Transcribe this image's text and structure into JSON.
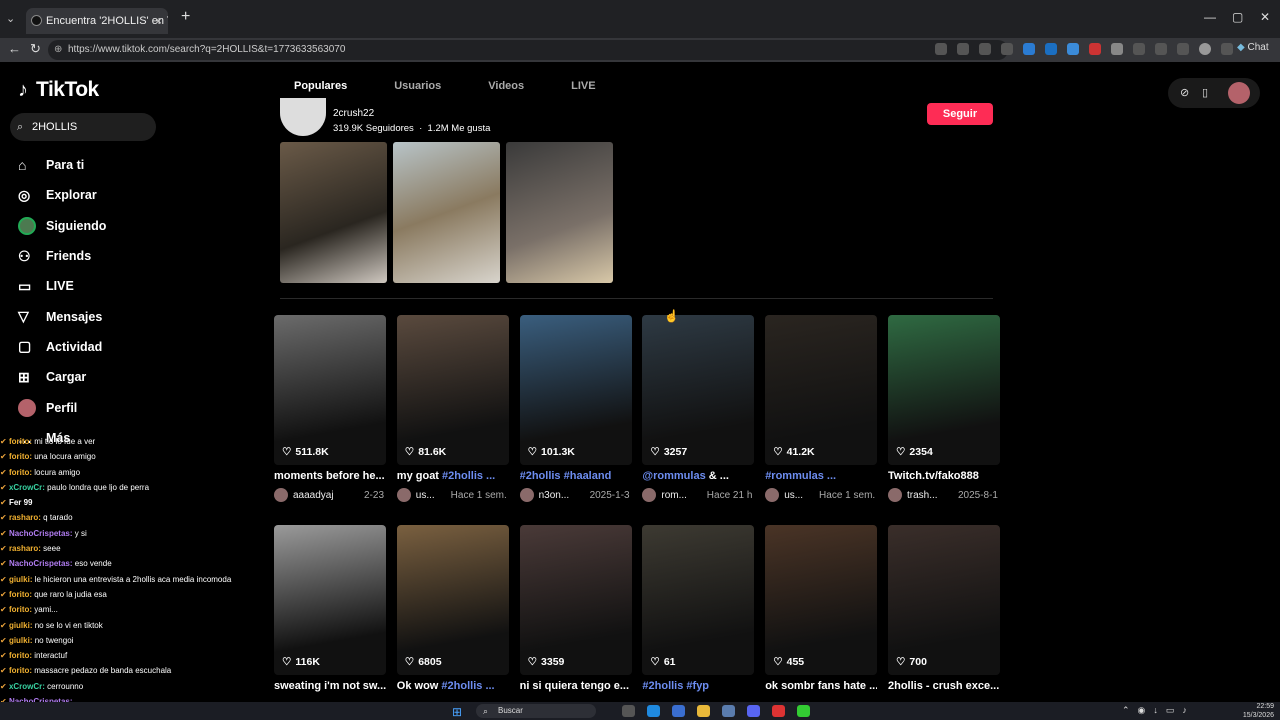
{
  "browser": {
    "tab_title": "Encuentra '2HOLLIS' en TikTok | Bu",
    "tab_close": "×",
    "new_tab": "+",
    "url": "https://www.tiktok.com/search?q=2HOLLIS&t=1773633563070",
    "chat_label": "Chat"
  },
  "app": {
    "logo": "TikTok",
    "search_value": "2HOLLIS"
  },
  "nav": [
    {
      "label": "Para ti",
      "icon": "home-icon"
    },
    {
      "label": "Explorar",
      "icon": "compass-icon"
    },
    {
      "label": "Siguiendo",
      "icon": "following-avatar"
    },
    {
      "label": "Friends",
      "icon": "friends-icon"
    },
    {
      "label": "LIVE",
      "icon": "live-icon"
    },
    {
      "label": "Mensajes",
      "icon": "messages-icon"
    },
    {
      "label": "Actividad",
      "icon": "activity-icon"
    },
    {
      "label": "Cargar",
      "icon": "upload-icon"
    },
    {
      "label": "Perfil",
      "icon": "profile-avatar"
    },
    {
      "label": "Más",
      "icon": "more-icon"
    }
  ],
  "search_tabs": [
    "Populares",
    "Usuarios",
    "Videos",
    "LIVE"
  ],
  "user_result": {
    "handle": "2crush22",
    "followers": "319.9K Seguidores",
    "separator": "·",
    "likes": "1.2M Me gusta",
    "follow_label": "Seguir"
  },
  "videos": [
    {
      "likes": "511.8K",
      "caption": "moments before he...",
      "tags": "",
      "author": "aaaadyaj",
      "date": "2-23",
      "color": "#6b6b6b"
    },
    {
      "likes": "81.6K",
      "caption": "my goat ",
      "tags": "#2hollis ...",
      "author": "us...",
      "date": "Hace 1 sem.",
      "color": "#5a4a3e"
    },
    {
      "likes": "101.3K",
      "caption": "",
      "tags": "#2hollis #haaland",
      "author": "n3on...",
      "date": "2025-1-3",
      "color": "#3a5e7e"
    },
    {
      "likes": "3257",
      "caption": " & ...",
      "tags": "@rommulas",
      "author": "rom...",
      "date": "Hace 21 h",
      "color": "#2e3a44"
    },
    {
      "likes": "41.2K",
      "caption": "",
      "tags": "#rommulas ...",
      "author": "us...",
      "date": "Hace 1 sem.",
      "color": "#2a2520"
    },
    {
      "likes": "2354",
      "caption": "Twitch.tv/fako888",
      "tags": "",
      "author": "trash...",
      "date": "2025-8-1",
      "color": "#2f6a42"
    },
    {
      "likes": "116K",
      "caption": "sweating i'm not sw...",
      "tags": "",
      "author": "",
      "date": "",
      "color": "#9a9a9a"
    },
    {
      "likes": "6805",
      "caption": "Ok wow ",
      "tags": "#2hollis ...",
      "author": "",
      "date": "",
      "color": "#7a6040"
    },
    {
      "likes": "3359",
      "caption": "ni si quiera tengo e...",
      "tags": "",
      "author": "",
      "date": "",
      "color": "#4a3a38"
    },
    {
      "likes": "61",
      "caption": "",
      "tags": "#2hollis #fyp",
      "author": "",
      "date": "",
      "color": "#3d3a32"
    },
    {
      "likes": "455",
      "caption": "ok sombr fans hate ...",
      "tags": "",
      "author": "",
      "date": "",
      "color": "#4a3426"
    },
    {
      "likes": "700",
      "caption": "2hollis - crush exce...",
      "tags": "",
      "author": "",
      "date": "",
      "color": "#3a2e2a"
    }
  ],
  "chat": [
    {
      "user": "forito:",
      "text": " mi tio lo fue a ver",
      "color": "#f0b030"
    },
    {
      "user": "forito:",
      "text": " una locura amigo",
      "color": "#f0b030"
    },
    {
      "user": "forito:",
      "text": " locura amigo",
      "color": "#f0b030"
    },
    {
      "user": "xCrowCr:",
      "text": " paulo londra que ljo de perra",
      "color": "#37d0a0"
    },
    {
      "user": "Fer 99",
      "text": "",
      "color": "#fff"
    },
    {
      "user": "rasharo:",
      "text": " q tarado",
      "color": "#f0b030"
    },
    {
      "user": "NachoCrispetas:",
      "text": " y si",
      "color": "#b07cf0"
    },
    {
      "user": "rasharo:",
      "text": " seee",
      "color": "#f0b030"
    },
    {
      "user": "NachoCrispetas:",
      "text": " eso vende",
      "color": "#b07cf0"
    },
    {
      "user": "giulki:",
      "text": " le hicieron una entrevista a 2hollis aca media incomoda",
      "color": "#f0b030"
    },
    {
      "user": "forito:",
      "text": " que raro la judia esa",
      "color": "#f0b030"
    },
    {
      "user": "forito:",
      "text": " yami...",
      "color": "#f0b030"
    },
    {
      "user": "giulki:",
      "text": " no se lo vi en tiktok",
      "color": "#f0b030"
    },
    {
      "user": "giulki:",
      "text": " no twengoi",
      "color": "#f0b030"
    },
    {
      "user": "forito:",
      "text": " interactuf",
      "color": "#f0b030"
    },
    {
      "user": "forito:",
      "text": " massacre pedazo de banda escuchala",
      "color": "#f0b030"
    },
    {
      "user": "xCrowCr:",
      "text": " cerrounno",
      "color": "#37d0a0"
    },
    {
      "user": "NachoCrispetas:",
      "text": "",
      "color": "#b07cf0"
    }
  ],
  "taskbar": {
    "search_label": "Buscar",
    "time": "22:59",
    "date": "15/3/2026"
  }
}
